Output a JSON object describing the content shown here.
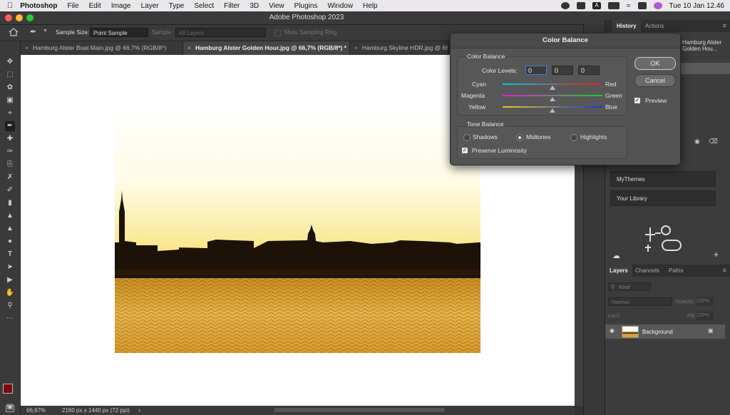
{
  "menubar": {
    "app": "Photoshop",
    "items": [
      "File",
      "Edit",
      "Image",
      "Layer",
      "Type",
      "Select",
      "Filter",
      "3D",
      "View",
      "Plugins",
      "Window",
      "Help"
    ],
    "clock": "Tue 10 Jan  12.46"
  },
  "window": {
    "title": "Adobe Photoshop 2023"
  },
  "options": {
    "sample_size_label": "Sample Size:",
    "sample_size_value": "Point Sample",
    "sample_label": "Sample:",
    "sample_value": "All Layers",
    "show_ring": "Show Sampling Ring"
  },
  "tabs": [
    {
      "label": "Hamburg Alster Boat Main.jpg @ 66,7% (RGB/8*)"
    },
    {
      "label": "Hamburg Alster Golden Hour.jpg @ 66,7% (RGB/8*) *"
    },
    {
      "label": "Hamburg Skyline HDR.jpg @ 66,"
    }
  ],
  "status": {
    "zoom": "66,67%",
    "doc": "2160 px x 1440 px (72 ppi)"
  },
  "history": {
    "tabs": [
      "History",
      "Actions"
    ],
    "item": "Hamburg Alster Golden Hou..."
  },
  "libraries": {
    "items": [
      "MyThemes",
      "Your Library"
    ]
  },
  "layers": {
    "tabs": [
      "Layers",
      "Channels",
      "Paths"
    ],
    "kind": "Kind",
    "blend": "Normal",
    "opacity_label": "Opacity:",
    "opacity_value": "100%",
    "lock_label": "Lock:",
    "fill_label": "Fill:",
    "fill_value": "100%",
    "layer_name": "Background"
  },
  "dialog": {
    "title": "Color Balance",
    "group1": "Color Balance",
    "levels_label": "Color Levels:",
    "levels": [
      "0",
      "0",
      "0"
    ],
    "sliders": [
      {
        "left": "Cyan",
        "right": "Red",
        "value": 0
      },
      {
        "left": "Magenta",
        "right": "Green",
        "value": 0
      },
      {
        "left": "Yellow",
        "right": "Blue",
        "value": 0
      }
    ],
    "group2": "Tone Balance",
    "tones": [
      "Shadows",
      "Midtones",
      "Highlights"
    ],
    "selected_tone": "Midtones",
    "preserve": "Preserve Luminosity",
    "ok": "OK",
    "cancel": "Cancel",
    "preview": "Preview"
  }
}
